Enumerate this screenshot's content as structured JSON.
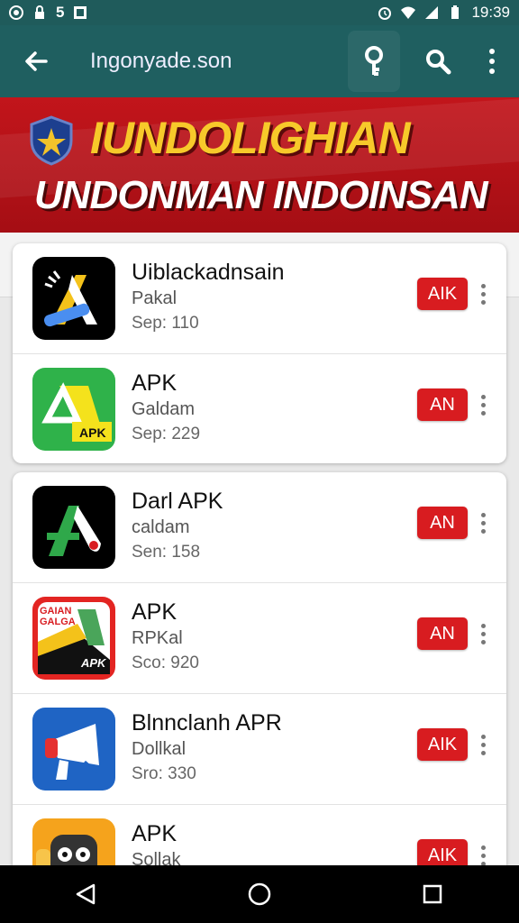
{
  "status_bar": {
    "time": "19:39",
    "left_icons": [
      "whatsapp-icon",
      "lock-icon",
      "five-icon",
      "notification-icon"
    ],
    "right_icons": [
      "alarm-icon",
      "wifi-icon",
      "signal-icon",
      "battery-icon"
    ]
  },
  "app_bar": {
    "url": "Ingonyade.son",
    "icons": [
      "back-arrow-icon",
      "key-icon",
      "search-icon",
      "more-vert-icon"
    ]
  },
  "banner": {
    "line1": "IUNDOLIGHIAN",
    "line2": "UNDONMAN INDOINSAN"
  },
  "cards": [
    {
      "items": [
        {
          "name": "Uiblackadnsain",
          "sub": "Pakal",
          "size": "Sep: 110",
          "button": "AIK"
        },
        {
          "name": "APK",
          "sub": "Galdam",
          "size": "Sep: 229",
          "button": "AN",
          "icon_badge": "APK"
        }
      ]
    },
    {
      "items": [
        {
          "name": "Darl APK",
          "sub": "caldam",
          "size": "Sen: 158",
          "button": "AN"
        },
        {
          "name": "APK",
          "sub": "RPKal",
          "size": "Sco: 920",
          "button": "AN",
          "icon_text_top": "GAIAN",
          "icon_text_mid": "GALGA",
          "icon_badge": "APK"
        },
        {
          "name": "Blnnclanh APR",
          "sub": "Dollkal",
          "size": "Sro: 330",
          "button": "AIK"
        },
        {
          "name": "APK",
          "sub": "Sollak",
          "size": "",
          "button": "AIK"
        }
      ]
    }
  ],
  "colors": {
    "app_bar": "#1f5f60",
    "banner": "#c2151b",
    "apk_button": "#d81c20",
    "banner_yellow": "#f7c92a"
  }
}
